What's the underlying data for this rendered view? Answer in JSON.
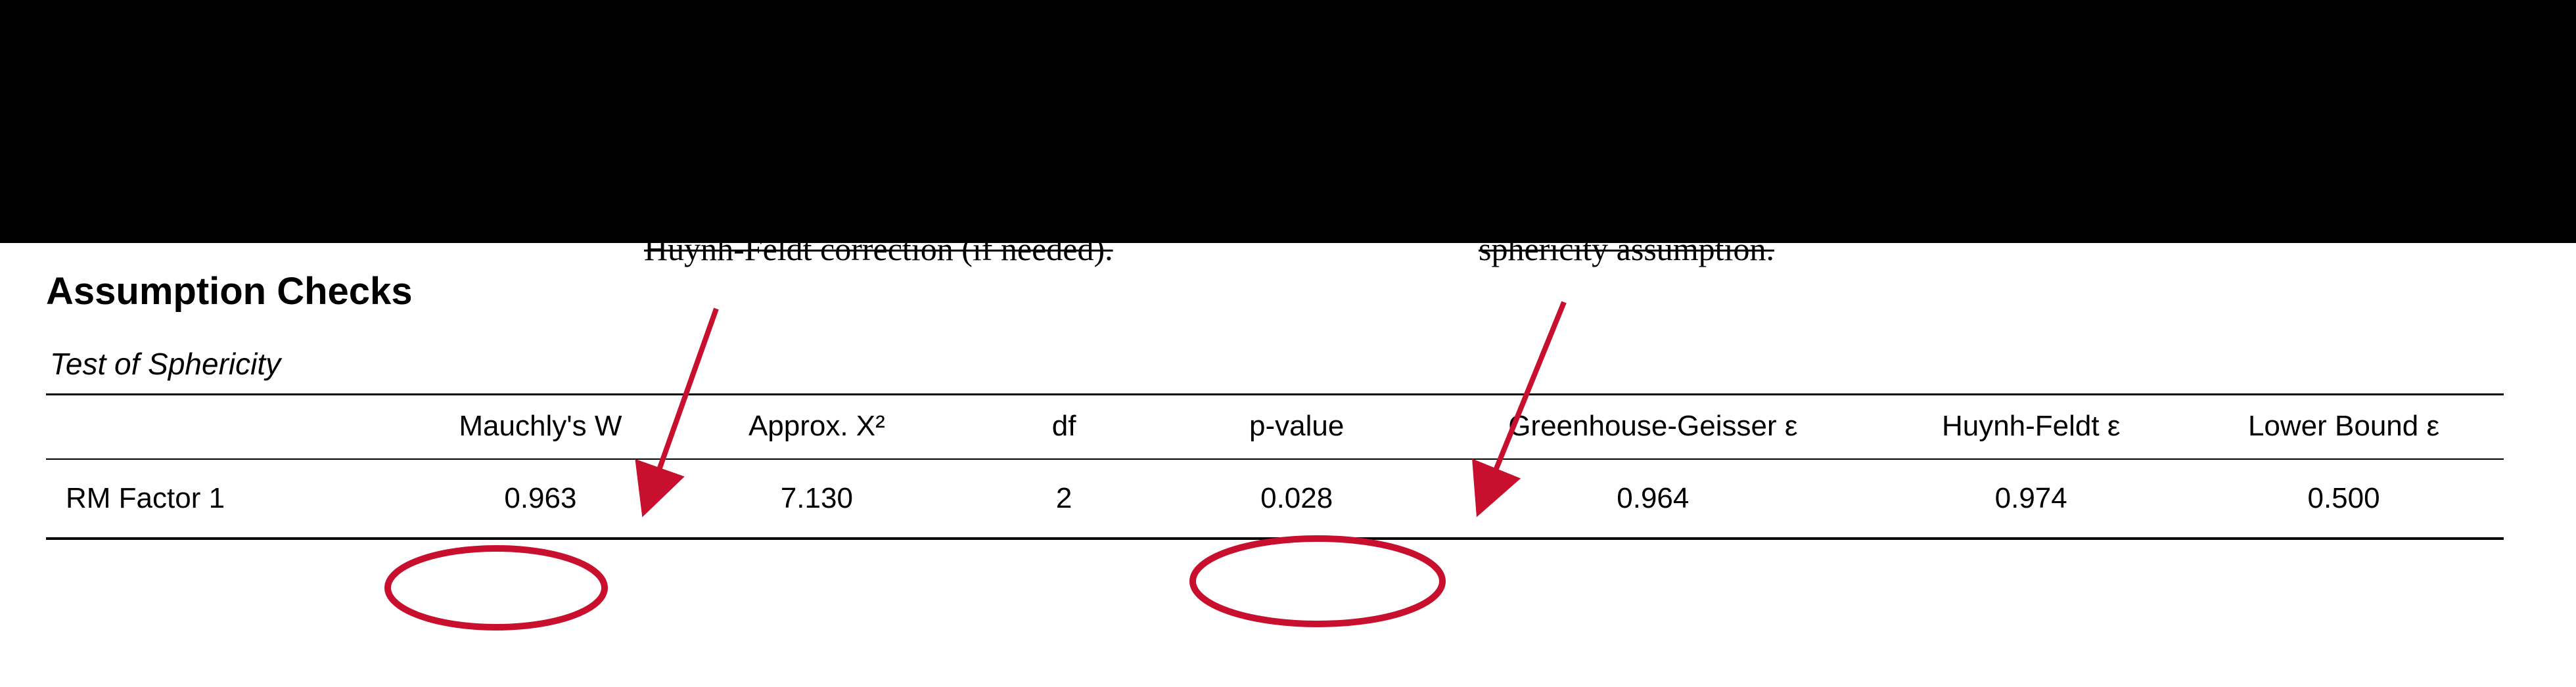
{
  "annotations": {
    "partial_left": "Huynh-Feldt correction (if needed).",
    "partial_right": "sphericity assumption."
  },
  "section": {
    "heading": "Assumption Checks",
    "table_title": "Test of Sphericity"
  },
  "table": {
    "headers": {
      "rowlabel": "",
      "mauchly": "Mauchly's W",
      "chi": "Approx. X²",
      "df": "df",
      "p": "p-value",
      "gg": "Greenhouse-Geisser ε",
      "hf": "Huynh-Feldt ε",
      "lb": "Lower Bound ε"
    },
    "row": {
      "label": "RM Factor 1",
      "mauchly": "0.963",
      "chi": "7.130",
      "df": "2",
      "p": "0.028",
      "gg": "0.964",
      "hf": "0.974",
      "lb": "0.500"
    }
  },
  "highlights": {
    "circle_mauchly": true,
    "circle_pvalue": true,
    "arrow_color": "#C8102E"
  }
}
